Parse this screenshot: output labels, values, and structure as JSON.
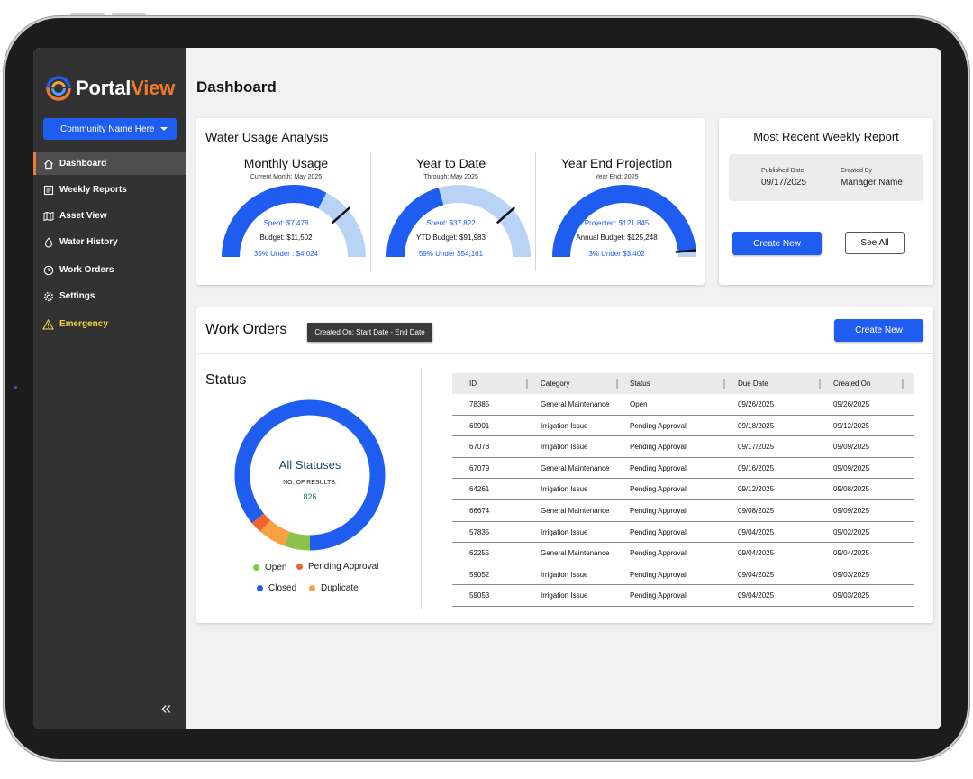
{
  "app": {
    "logo_part1": "Portal",
    "logo_part2": "View",
    "community_select": "Community Name Here",
    "page_title": "Dashboard"
  },
  "sidebar": {
    "items": [
      {
        "label": "Dashboard",
        "icon": "home-icon"
      },
      {
        "label": "Weekly Reports",
        "icon": "report-icon"
      },
      {
        "label": "Asset View",
        "icon": "map-icon"
      },
      {
        "label": "Water History",
        "icon": "water-drop-icon"
      },
      {
        "label": "Work Orders",
        "icon": "clock-icon"
      },
      {
        "label": "Settings",
        "icon": "gear-icon"
      },
      {
        "label": "Emergency",
        "icon": "warning-icon"
      }
    ],
    "collapse_glyph": "«"
  },
  "water_usage": {
    "title": "Water Usage Analysis",
    "gauges": [
      {
        "title": "Monthly Usage",
        "sub": "Current Month: May 2025",
        "line1": "Spent: $7,478",
        "line2": "Budget: $11,502",
        "line3": "35% Under : $4,024",
        "fill_fraction": 0.65,
        "marker_fraction": 0.77
      },
      {
        "title": "Year to Date",
        "sub": "Through: May 2025",
        "line1": "Spent: $37,822",
        "line2": "YTD Budget: $91,983",
        "line3": "59% Under $54,161",
        "fill_fraction": 0.41,
        "marker_fraction": 0.77
      },
      {
        "title": "Year End Projection",
        "sub": "Year End: 2025",
        "line1": "Projected: $121,845",
        "line2": "Annual Budget: $125,248",
        "line3": "3% Under $3,402",
        "fill_fraction": 0.97,
        "marker_fraction": 0.97
      }
    ]
  },
  "weekly_report": {
    "title": "Most Recent Weekly Report",
    "published_label": "Published Date",
    "published_value": "09/17/2025",
    "created_label": "Created By",
    "created_value": "Manager Name",
    "create_btn": "Create New",
    "see_all_btn": "See All"
  },
  "work_orders": {
    "title": "Work Orders",
    "date_filter": "Created On: Start Date - End Date",
    "create_btn": "Create New",
    "status_title": "Status",
    "donut_center": "All Statuses",
    "results_label": "NO. OF RESULTS:",
    "results_value": "826",
    "legend": [
      {
        "label": "Open",
        "color": "#8bc34a"
      },
      {
        "label": "Pending Approval",
        "color": "#f0622e"
      },
      {
        "label": "Closed",
        "color": "#1f5cf0"
      },
      {
        "label": "Duplicate",
        "color": "#f7a044"
      }
    ],
    "status_breakdown": [
      {
        "label": "Closed",
        "fraction": 0.86
      },
      {
        "label": "Open",
        "fraction": 0.055
      },
      {
        "label": "Duplicate",
        "fraction": 0.06
      },
      {
        "label": "Pending Approval",
        "fraction": 0.025
      }
    ],
    "columns": [
      "ID",
      "Category",
      "Status",
      "Due Date",
      "Created On"
    ],
    "rows": [
      [
        "78385",
        "General Maintenance",
        "Open",
        "09/26/2025",
        "09/26/2025"
      ],
      [
        "69901",
        "Irrigation Issue",
        "Pending Approval",
        "09/18/2025",
        "09/12/2025"
      ],
      [
        "67078",
        "Irrigation Issue",
        "Pending Approval",
        "09/17/2025",
        "09/09/2025"
      ],
      [
        "67079",
        "General Maintenance",
        "Pending Approval",
        "09/16/2025",
        "09/09/2025"
      ],
      [
        "64261",
        "Irrigation Issue",
        "Pending Approval",
        "09/12/2025",
        "09/08/2025"
      ],
      [
        "66674",
        "General Maintenance",
        "Pending Approval",
        "09/08/2025",
        "09/09/2025"
      ],
      [
        "57835",
        "Irrigation Issue",
        "Pending Approval",
        "09/04/2025",
        "09/02/2025"
      ],
      [
        "62255",
        "General Maintenance",
        "Pending Approval",
        "09/04/2025",
        "09/04/2025"
      ],
      [
        "59052",
        "Irrigation Issue",
        "Pending Approval",
        "09/04/2025",
        "09/03/2025"
      ],
      [
        "59053",
        "Irrigation Issue",
        "Pending Approval",
        "09/04/2025",
        "09/03/2025"
      ]
    ]
  },
  "colors": {
    "brand_blue": "#1f5cf0",
    "light_blue": "#b9d3f7",
    "brand_orange": "#f07a28",
    "sidebar_bg": "#323232",
    "emergency": "#f2d543"
  }
}
